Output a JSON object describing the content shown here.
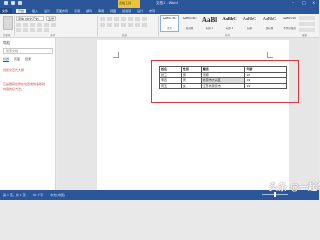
{
  "titlebar": {
    "context_tab": "表格工具",
    "doc_title": "文档1 - Word"
  },
  "tabs": {
    "file": "文件",
    "items": [
      "开始",
      "插入",
      "设计",
      "页面布局",
      "引用",
      "邮件",
      "审阅",
      "视图",
      "加载项",
      "设计",
      "布局"
    ],
    "active_index": 0
  },
  "ribbon": {
    "font_name": "宋体 (中文正文)",
    "font_size": "五号",
    "groups": [
      "剪贴板",
      "字体",
      "段落",
      "样式",
      "编辑"
    ],
    "styles": [
      {
        "sample": "AaBbCcDc",
        "name": "正文",
        "selected": true
      },
      {
        "sample": "AaBbCcDc",
        "name": "无间隔",
        "selected": false
      },
      {
        "sample": "AaBl",
        "name": "标题 1",
        "selected": false
      },
      {
        "sample": "AaBbC",
        "name": "标题 2",
        "selected": false
      },
      {
        "sample": "AaBbC",
        "name": "标题",
        "selected": false
      },
      {
        "sample": "AaBbC",
        "name": "副标题",
        "selected": false
      },
      {
        "sample": "AaBbCcDt",
        "name": "不明显强调",
        "selected": false
      }
    ]
  },
  "nav_pane": {
    "title": "导航",
    "search_placeholder": "搜索文档",
    "tabs": [
      "标题",
      "页面",
      "结果"
    ],
    "text_lines": [
      "创建交互式大纲",
      "",
      "它是跟踪您所在位置或快速移动",
      "内容的好方法。"
    ]
  },
  "table": {
    "headers": [
      "姓名",
      "性别",
      "籍贯",
      "年龄"
    ],
    "rows": [
      [
        "张三",
        "男",
        "河南",
        "16"
      ],
      [
        "李四",
        "男",
        "北京市大兴区",
        "18"
      ],
      [
        "周五",
        "女",
        "江苏省南京市",
        "19"
      ]
    ],
    "selected_cell": [
      1,
      2
    ]
  },
  "statusbar": {
    "items": [
      "第 1 页，共 1 页",
      "30 个字",
      "中文(中国)"
    ]
  },
  "watermark": "头条 @一起学"
}
